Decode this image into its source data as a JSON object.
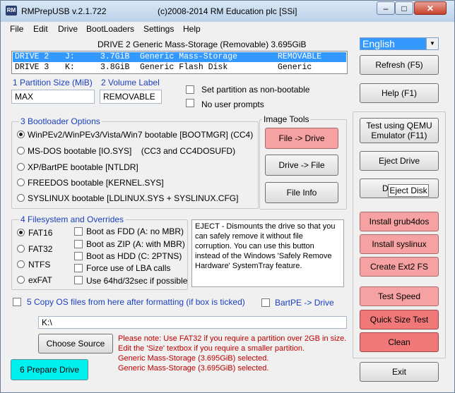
{
  "window": {
    "app_icon": "RM",
    "title": "RMPrepUSB v.2.1.722",
    "title_center": "(c)2008-2014 RM Education plc [SSi]",
    "controls": {
      "minimize": "–",
      "maximize": "□",
      "close": "✕"
    }
  },
  "menu": [
    "File",
    "Edit",
    "Drive",
    "BootLoaders",
    "Settings",
    "Help"
  ],
  "drive_header": "DRIVE 2 Generic Mass-Storage  (Removable) 3.695GiB",
  "language": {
    "selected": "English",
    "arrow": "▼"
  },
  "drives": [
    {
      "drive": "DRIVE 2",
      "letter": "J:",
      "size": "3.7GiB",
      "name": "Generic Mass-Storage",
      "type": "REMOVABLE",
      "selected": true
    },
    {
      "drive": "DRIVE 3",
      "letter": "K:",
      "size": "3.8GiB",
      "name": "Generic Flash Disk",
      "type": "Generic",
      "selected": false
    }
  ],
  "partition": {
    "label": "1 Partition Size (MiB)",
    "value": "MAX"
  },
  "volume": {
    "label": "2 Volume Label",
    "value": "REMOVABLE"
  },
  "options": {
    "non_bootable": "Set partition as non-bootable",
    "no_prompts": "No user prompts"
  },
  "bootloader": {
    "title": "3 Bootloader Options",
    "items": [
      {
        "text": "WinPEv2/WinPEv3/Vista/Win7 bootable [BOOTMGR] (CC4)",
        "checked": true
      },
      {
        "text": "MS-DOS bootable [IO.SYS]    (CC3 and CC4DOSUFD)",
        "checked": false
      },
      {
        "text": "XP/BartPE bootable [NTLDR]",
        "checked": false
      },
      {
        "text": "FREEDOS bootable [KERNEL.SYS]",
        "checked": false
      },
      {
        "text": "SYSLINUX bootable [LDLINUX.SYS + SYSLINUX.CFG]",
        "checked": false
      }
    ]
  },
  "image_tools": {
    "title": "Image Tools",
    "file_to_drive": "File -> Drive",
    "drive_to_file": "Drive -> File",
    "file_info": "File Info"
  },
  "filesystem": {
    "title": "4 Filesystem and Overrides",
    "fs": [
      {
        "text": "FAT16",
        "checked": true
      },
      {
        "text": "FAT32",
        "checked": false
      },
      {
        "text": "NTFS",
        "checked": false
      },
      {
        "text": "exFAT",
        "checked": false
      }
    ],
    "overrides": [
      "Boot as FDD (A: no MBR)",
      "Boot as ZIP (A: with MBR)",
      "Boot as HDD (C: 2PTNS)",
      "Force use of LBA calls",
      "Use 64hd/32sec if possible"
    ]
  },
  "help_text": "EJECT - Dismounts the drive so that you can safely remove it without file corruption. You can use this button instead of the Windows 'Safely Remove Hardware' SystemTray feature.",
  "copy_os": {
    "label": "5 Copy OS files from here after formatting (if box is ticked)",
    "path": "K:\\",
    "bartpe": "BartPE -> Drive"
  },
  "choose_source": "Choose Source",
  "prepare_drive": "6 Prepare Drive",
  "notes": [
    "Please note: Use FAT32 if you require a partition over 2GB in size.",
    "Edit the 'Size' textbox if you require a smaller partition.",
    "Generic Mass-Storage (3.695GiB) selected.",
    "Generic Mass-Storage (3.695GiB) selected."
  ],
  "right_buttons": {
    "refresh": "Refresh (F5)",
    "help": "Help (F1)",
    "qemu_line1": "Test using QEMU",
    "qemu_line2": "Emulator (F11)",
    "eject_drive": "Eject Drive",
    "drive_info_partial": "Dr",
    "tooltip": "Eject Disk",
    "grub4dos": "Install grub4dos",
    "syslinux": "Install syslinux",
    "ext2": "Create Ext2 FS",
    "test_speed": "Test Speed",
    "quick_size": "Quick Size Test",
    "clean": "Clean",
    "exit": "Exit"
  },
  "colors": {
    "pink": "#f7a2a2",
    "rose": "#f07878",
    "cyan": "#00f0f0",
    "selection": "#3399ff",
    "note_red": "#c00000",
    "label_blue": "#1a3fbf"
  }
}
